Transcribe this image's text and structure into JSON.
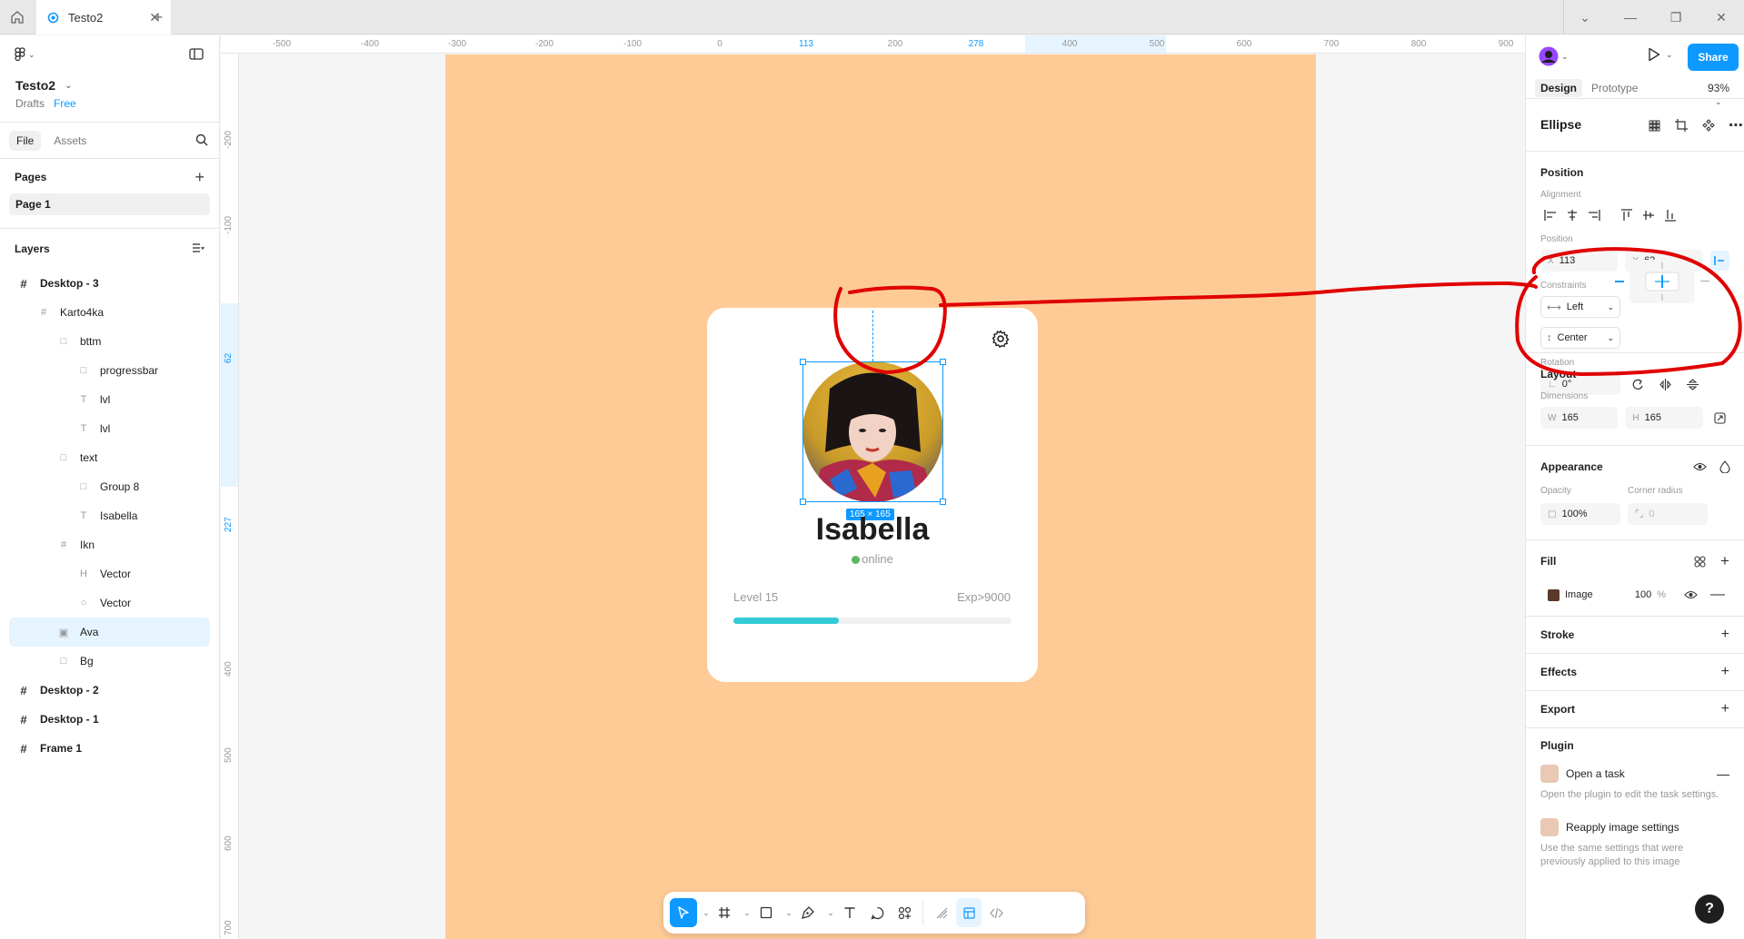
{
  "tabbar": {
    "tab_title": "Testo2",
    "add": "+"
  },
  "file": {
    "name": "Testo2",
    "location": "Drafts",
    "plan": "Free"
  },
  "left_tabs": [
    "File",
    "Assets"
  ],
  "pages": {
    "title": "Pages",
    "items": [
      "Page 1"
    ]
  },
  "layers": {
    "title": "Layers",
    "items": [
      {
        "name": "Desktop - 3",
        "icon": "#",
        "depth": 0
      },
      {
        "name": "Karto4ka",
        "icon": "#",
        "depth": 1
      },
      {
        "name": "bttm",
        "icon": "□",
        "depth": 2
      },
      {
        "name": "progressbar",
        "icon": "□",
        "depth": 3
      },
      {
        "name": "lvl",
        "icon": "T",
        "depth": 3
      },
      {
        "name": "lvl",
        "icon": "T",
        "depth": 3
      },
      {
        "name": "text",
        "icon": "□",
        "depth": 2
      },
      {
        "name": "Group 8",
        "icon": "□",
        "depth": 3
      },
      {
        "name": "Isabella",
        "icon": "T",
        "depth": 3
      },
      {
        "name": "Ikn",
        "icon": "#",
        "depth": 2
      },
      {
        "name": "Vector",
        "icon": "H",
        "depth": 3
      },
      {
        "name": "Vector",
        "icon": "○",
        "depth": 3
      },
      {
        "name": "Ava",
        "icon": "▣",
        "depth": 2,
        "selected": true
      },
      {
        "name": "Bg",
        "icon": "□",
        "depth": 2
      },
      {
        "name": "Desktop - 2",
        "icon": "#",
        "depth": 0
      },
      {
        "name": "Desktop - 1",
        "icon": "#",
        "depth": 0
      },
      {
        "name": "Frame 1",
        "icon": "#",
        "depth": 0
      }
    ]
  },
  "ruler_h": [
    "-500",
    "-400",
    "-300",
    "-200",
    "-100",
    "0",
    "113",
    "200",
    "278",
    "400",
    "500",
    "600",
    "700",
    "800",
    "900"
  ],
  "ruler_v": [
    "-200",
    "-100",
    "62",
    "227",
    "400",
    "500",
    "600",
    "700"
  ],
  "card": {
    "name": "Isabella",
    "status": "online",
    "level": "Level 15",
    "exp": "Exp>9000",
    "progress": 0.38,
    "size_badge": "165 × 165"
  },
  "right": {
    "share": "Share",
    "tabs": [
      "Design",
      "Prototype"
    ],
    "zoom": "93%",
    "element": "Ellipse",
    "position_title": "Position",
    "alignment_label": "Alignment",
    "position_label": "Position",
    "x": "113",
    "y": "62",
    "constraints_label": "Constraints",
    "constraint_h": "Left",
    "constraint_v": "Center",
    "rotation_label": "Rotation",
    "rotation": "0°",
    "layout_title": "Layout",
    "dimensions_label": "Dimensions",
    "w": "165",
    "h": "165",
    "appearance_title": "Appearance",
    "opacity_label": "Opacity",
    "corner_label": "Corner radius",
    "opacity": "100%",
    "corner": "0",
    "fill_title": "Fill",
    "fill_type": "Image",
    "fill_opacity": "100",
    "fill_unit": "%",
    "stroke_title": "Stroke",
    "effects_title": "Effects",
    "export_title": "Export",
    "plugin_title": "Plugin",
    "plugins": [
      {
        "title": "Open a task",
        "desc": "Open the plugin to edit the task settings."
      },
      {
        "title": "Reapply image settings",
        "desc": "Use the same settings that were previously applied to this image"
      }
    ]
  },
  "colors": {
    "accent": "#0d99ff",
    "frame": "#fecb97",
    "progress": "#33ccd6",
    "annotation": "#e00000"
  }
}
